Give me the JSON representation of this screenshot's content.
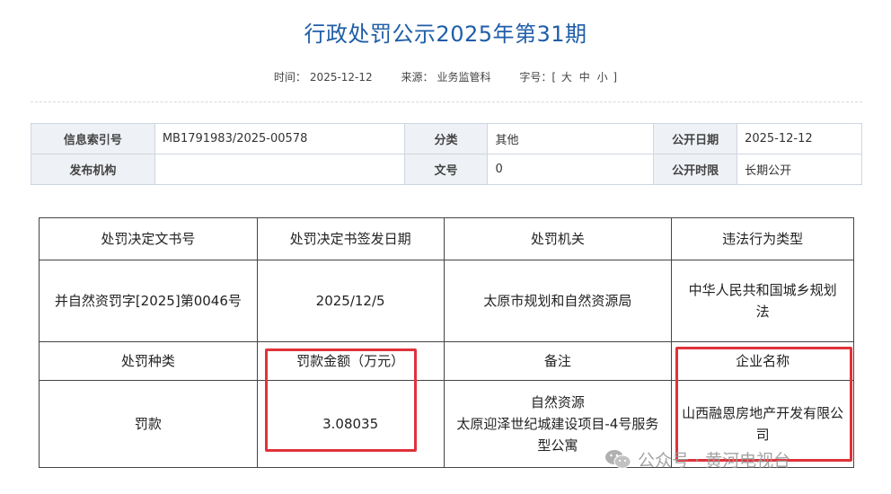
{
  "page": {
    "title": "行政处罚公示2025年第31期",
    "meta": {
      "time_label": "时间：",
      "time_value": "2025-12-12",
      "source_label": "来源：",
      "source_value": "业务监管科",
      "fontsize_label": "字号：[",
      "fontsize_large": "大",
      "fontsize_medium": "中",
      "fontsize_small": "小",
      "fontsize_end": "]"
    }
  },
  "info_table": {
    "row1": [
      {
        "key": "信息索引号",
        "value": "MB1791983/2025-00578"
      },
      {
        "key": "分类",
        "value": "其他"
      },
      {
        "key": "公开日期",
        "value": "2025-12-12"
      }
    ],
    "row2": [
      {
        "key": "发布机构",
        "value": ""
      },
      {
        "key": "文号",
        "value": "0"
      },
      {
        "key": "公开时限",
        "value": "长期公开"
      }
    ]
  },
  "penalty_table": {
    "headers1": [
      "处罚决定文书号",
      "处罚决定书签发日期",
      "处罚机关",
      "违法行为类型"
    ],
    "values1": [
      "并自然资罚字[2025]第0046号",
      "2025/12/5",
      "太原市规划和自然资源局",
      "中华人民共和国城乡规划法"
    ],
    "headers2": [
      "处罚种类",
      "罚款金额（万元）",
      "备注",
      "企业名称"
    ],
    "values2": {
      "type": "罚款",
      "amount": "3.08035",
      "remark_line1": "自然资源",
      "remark_line2": "太原迎泽世纪城建设项目-4号服务型公寓",
      "company": "山西融恩房地产开发有限公司"
    }
  },
  "highlights": {
    "color": "#e0323a",
    "targets": [
      "罚款金额（万元）",
      "企业名称"
    ]
  },
  "watermark": {
    "text": "公众号 · 黄河电视台",
    "icon": "wechat-icon"
  }
}
